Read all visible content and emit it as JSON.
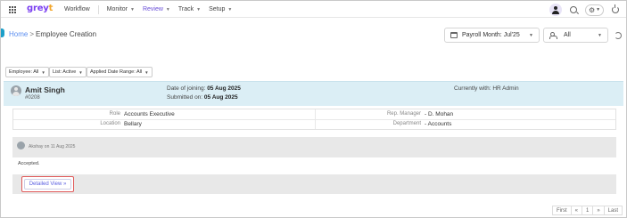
{
  "nav": {
    "logo_main": "grey",
    "logo_accent": "t",
    "items": [
      {
        "label": "Workflow"
      },
      {
        "label": "Monitor"
      },
      {
        "label": "Review"
      },
      {
        "label": "Track"
      },
      {
        "label": "Setup"
      }
    ],
    "active": "Review"
  },
  "breadcrumb": {
    "home": "Home",
    "separator": ">",
    "current": "Employee Creation"
  },
  "payroll": {
    "label": "Payroll Month:",
    "value": "Jul'25"
  },
  "scope": {
    "value": "All"
  },
  "filters": [
    {
      "label": "Employee: All"
    },
    {
      "label": "List: Active"
    },
    {
      "label": "Applied Date Range: All"
    }
  ],
  "employee": {
    "name": "Amit Singh",
    "id": "#0208",
    "doj_label": "Date of joining:",
    "doj_value": "05 Aug 2025",
    "submitted_label": "Submitted on:",
    "submitted_value": "05 Aug 2025",
    "currently_with": "Currently with: HR Admin"
  },
  "details": {
    "role_label": "Role",
    "role_value": "Accounts Executive",
    "manager_label": "Rep. Manager",
    "manager_value": "D. Mohan",
    "location_label": "Location",
    "location_value": "Bellary",
    "department_label": "Department",
    "department_value": "Accounts"
  },
  "comment": {
    "who": "Akshay on 11 Aug 2025",
    "status": "Accepted."
  },
  "detailed_view": {
    "label": "Detailed View »"
  },
  "pagination": {
    "first": "First",
    "prev": "«",
    "page": "1",
    "next": "»",
    "last": "Last"
  },
  "colors": {
    "brand": "#7a3ff0",
    "accent_blue": "#dbeef5",
    "highlight": "#e05a5a"
  }
}
